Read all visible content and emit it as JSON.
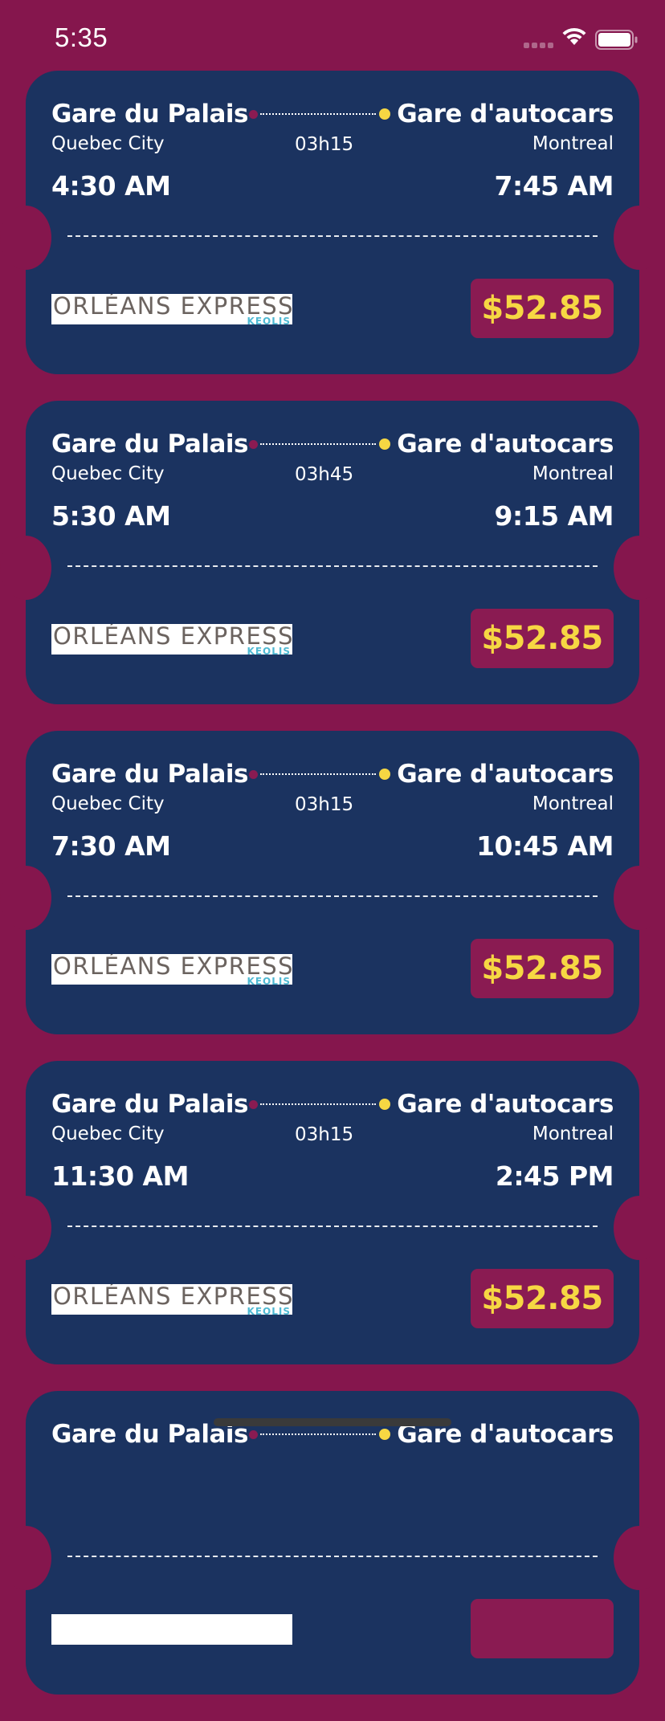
{
  "status_bar": {
    "time": "5:35"
  },
  "colors": {
    "background": "#85164d",
    "card": "#1b3360",
    "price_accent": "#f6d743",
    "price_bg": "#8a1b52"
  },
  "icons": {
    "signal": "cellular-signal-icon",
    "wifi": "wifi-icon",
    "battery": "battery-icon"
  },
  "trips": [
    {
      "from_station": "Gare du Palais",
      "to_station": "Gare d'autocars",
      "from_city": "Quebec City",
      "to_city": "Montreal",
      "duration": "03h15",
      "departure": "4:30 AM",
      "arrival": "7:45 AM",
      "operator": "orléans express",
      "operator_sub": "keolis",
      "price": "$52.85"
    },
    {
      "from_station": "Gare du Palais",
      "to_station": "Gare d'autocars",
      "from_city": "Quebec City",
      "to_city": "Montreal",
      "duration": "03h45",
      "departure": "5:30 AM",
      "arrival": "9:15 AM",
      "operator": "orléans express",
      "operator_sub": "keolis",
      "price": "$52.85"
    },
    {
      "from_station": "Gare du Palais",
      "to_station": "Gare d'autocars",
      "from_city": "Quebec City",
      "to_city": "Montreal",
      "duration": "03h15",
      "departure": "7:30 AM",
      "arrival": "10:45 AM",
      "operator": "orléans express",
      "operator_sub": "keolis",
      "price": "$52.85"
    },
    {
      "from_station": "Gare du Palais",
      "to_station": "Gare d'autocars",
      "from_city": "Quebec City",
      "to_city": "Montreal",
      "duration": "03h15",
      "departure": "11:30 AM",
      "arrival": "2:45 PM",
      "operator": "orléans express",
      "operator_sub": "keolis",
      "price": "$52.85"
    },
    {
      "from_station": "Gare du Palais",
      "to_station": "Gare d'autocars",
      "from_city": "",
      "to_city": "",
      "duration": "",
      "departure": "",
      "arrival": "",
      "operator": "",
      "operator_sub": "",
      "price": ""
    }
  ]
}
